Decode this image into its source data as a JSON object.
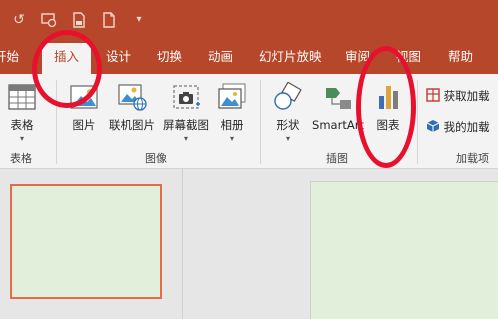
{
  "colors": {
    "ribbon_accent": "#b7472a",
    "ribbon_background": "#f3f3f3",
    "slide_fill": "#e2efda",
    "selected_thumbnail_border": "#e46c4b",
    "annotation_circle": "#e8112d"
  },
  "quick_access": {
    "icons": [
      "undo-icon",
      "slideshow-from-start-icon",
      "save-icon",
      "new-file-icon",
      "customize-dropdown-icon"
    ]
  },
  "tabs": [
    {
      "label": "开始"
    },
    {
      "label": "插入"
    },
    {
      "label": "设计"
    },
    {
      "label": "切换"
    },
    {
      "label": "动画"
    },
    {
      "label": "幻灯片放映"
    },
    {
      "label": "审阅"
    },
    {
      "label": "视图"
    },
    {
      "label": "帮助"
    }
  ],
  "active_tab": "插入",
  "ribbon": {
    "groups": {
      "table": "表格",
      "images": "图像",
      "illustrations": "插图",
      "addins": "加载项"
    },
    "buttons": {
      "table": "表格",
      "pictures": "图片",
      "online_pictures": "联机图片",
      "screenshot": "屏幕截图",
      "album": "相册",
      "shapes": "形状",
      "smartart": "SmartArt",
      "chart": "图表",
      "get_addins": "获取加载",
      "my_addins": "我的加载"
    }
  }
}
